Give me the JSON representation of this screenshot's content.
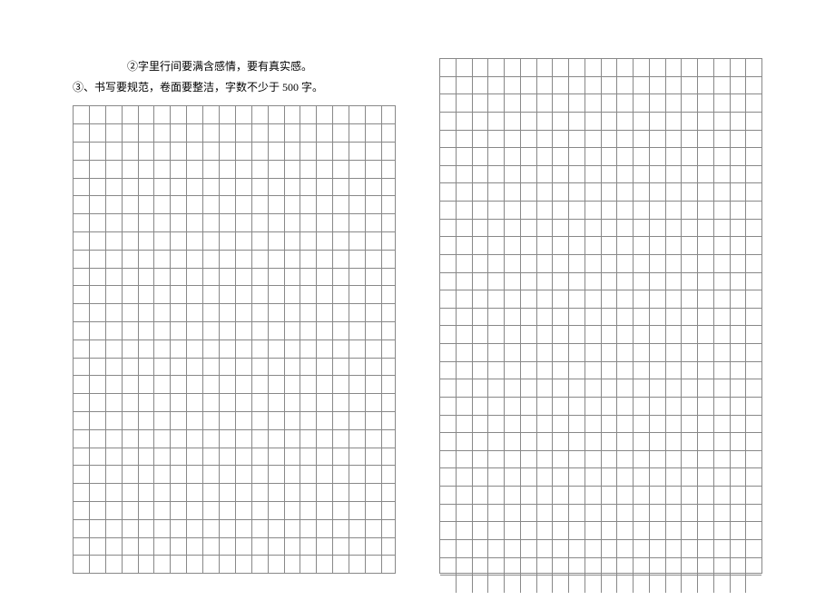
{
  "instructions": {
    "line1": "②字里行间要满含感情，要有真实感。",
    "line2": "③、书写要规范，卷面要整洁，字数不少于 500 字。"
  },
  "grid": {
    "leftColumns": 20,
    "leftRows": 26,
    "rightColumns": 20,
    "rightRows": 30
  }
}
